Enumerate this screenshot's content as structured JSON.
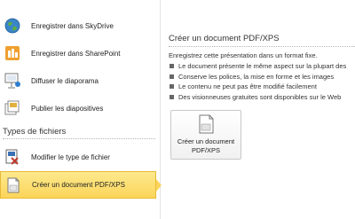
{
  "left_panel": {
    "items": [
      {
        "label": "Enregistrer dans SkyDrive",
        "icon": "skydrive-globe-icon"
      },
      {
        "label": "Enregistrer dans SharePoint",
        "icon": "sharepoint-icon"
      },
      {
        "label": "Diffuser le diaporama",
        "icon": "broadcast-slideshow-icon"
      },
      {
        "label": "Publier les diapositives",
        "icon": "publish-slides-icon"
      }
    ],
    "section_title": "Types de fichiers",
    "file_types": [
      {
        "label": "Modifier le type de fichier",
        "icon": "change-file-type-icon"
      },
      {
        "label": "Créer un document PDF/XPS",
        "icon": "pdf-xps-document-icon",
        "selected": true
      }
    ]
  },
  "right_panel": {
    "title": "Créer un document PDF/XPS",
    "intro": "Enregistrez cette présentation dans un format fixe.",
    "bullets": [
      "Le document présente le même aspect sur la plupart des",
      "Conserve les polices, la mise en forme et les images",
      "Le contenu ne peut pas être modifié facilement",
      "Des visionneuses gratuites sont disponibles sur le Web"
    ],
    "button_line1": "Créer un document",
    "button_line2": "PDF/XPS",
    "button_icon": "pdf-xps-document-icon"
  },
  "colors": {
    "selected_fill": "#fbd55a",
    "selected_border": "#e9b936"
  }
}
